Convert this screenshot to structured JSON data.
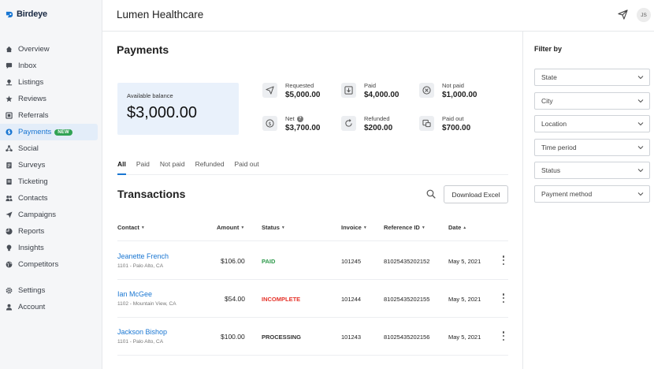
{
  "brand": {
    "name": "Birdeye",
    "accent": "#1976d2"
  },
  "header": {
    "company": "Lumen Healthcare",
    "avatar_initials": "JS"
  },
  "sidebar": {
    "items": [
      {
        "label": "Overview",
        "icon": "home-icon"
      },
      {
        "label": "Inbox",
        "icon": "chat-icon"
      },
      {
        "label": "Listings",
        "icon": "pin-icon"
      },
      {
        "label": "Reviews",
        "icon": "star-icon"
      },
      {
        "label": "Referrals",
        "icon": "referral-icon"
      },
      {
        "label": "Payments",
        "icon": "dollar-icon",
        "active": true,
        "badge": "NEW"
      },
      {
        "label": "Social",
        "icon": "share-icon"
      },
      {
        "label": "Surveys",
        "icon": "clipboard-icon"
      },
      {
        "label": "Ticketing",
        "icon": "ticket-icon"
      },
      {
        "label": "Contacts",
        "icon": "people-icon"
      },
      {
        "label": "Campaigns",
        "icon": "send-icon"
      },
      {
        "label": "Reports",
        "icon": "chart-icon"
      },
      {
        "label": "Insights",
        "icon": "bulb-icon"
      },
      {
        "label": "Competitors",
        "icon": "globe-icon"
      }
    ],
    "bottom_items": [
      {
        "label": "Settings",
        "icon": "gear-icon"
      },
      {
        "label": "Account",
        "icon": "user-icon"
      }
    ]
  },
  "main": {
    "title": "Payments",
    "balance": {
      "label": "Available balance",
      "value": "$3,000.00"
    },
    "stats": [
      {
        "label": "Requested",
        "value": "$5,000.00",
        "icon": "send-icon"
      },
      {
        "label": "Paid",
        "value": "$4,000.00",
        "icon": "download-icon"
      },
      {
        "label": "Not paid",
        "value": "$1,000.00",
        "icon": "x-circle-icon"
      },
      {
        "label": "Net",
        "value": "$3,700.00",
        "icon": "dollar-circle-icon",
        "help": "?"
      },
      {
        "label": "Refunded",
        "value": "$200.00",
        "icon": "refresh-icon"
      },
      {
        "label": "Paid out",
        "value": "$700.00",
        "icon": "payout-icon"
      }
    ],
    "tabs": [
      "All",
      "Paid",
      "Not paid",
      "Refunded",
      "Paid out"
    ],
    "transactions": {
      "title": "Transactions",
      "download_label": "Download Excel",
      "columns": [
        "Contact",
        "Amount",
        "Status",
        "Invoice",
        "Reference ID",
        "Date"
      ],
      "rows": [
        {
          "name": "Jeanette French",
          "sub": "1101 - Palo Alto, CA",
          "amount": "$106.00",
          "status": "PAID",
          "invoice": "101245",
          "ref": "81025435202152",
          "date": "May 5, 2021"
        },
        {
          "name": "Ian McGee",
          "sub": "1102 - Mountain View, CA",
          "amount": "$54.00",
          "status": "INCOMPLETE",
          "invoice": "101244",
          "ref": "81025435202155",
          "date": "May 5, 2021"
        },
        {
          "name": "Jackson Bishop",
          "sub": "1101 - Palo Alto, CA",
          "amount": "$100.00",
          "status": "PROCESSING",
          "invoice": "101243",
          "ref": "81025435202156",
          "date": "May 5, 2021"
        }
      ]
    }
  },
  "filter": {
    "title": "Filter by",
    "fields": [
      "State",
      "City",
      "Location",
      "Time period",
      "Status",
      "Payment method"
    ]
  }
}
